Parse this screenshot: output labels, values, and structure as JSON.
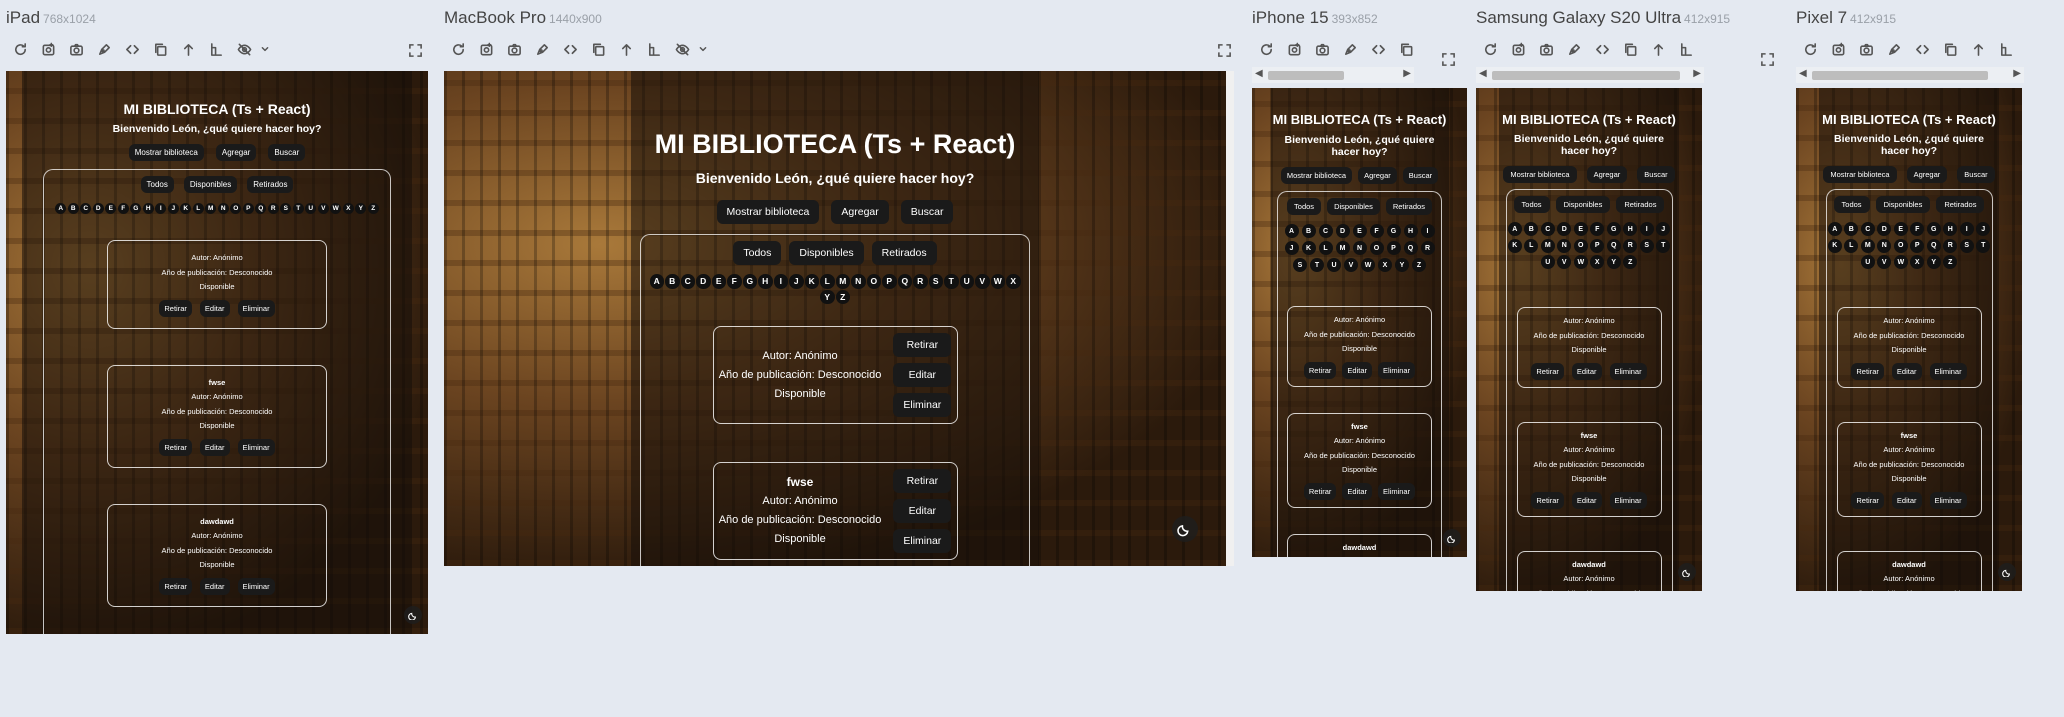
{
  "toolbar_icons": [
    "refresh-icon",
    "screenshot-icon",
    "camera-icon",
    "pen-icon",
    "code-icon",
    "copy-icon",
    "upload-icon",
    "rotate-icon",
    "hide-icon",
    "chevron-down-icon"
  ],
  "devices": {
    "ipad": {
      "name": "iPad",
      "dims": "768x1024"
    },
    "macbook": {
      "name": "MacBook Pro",
      "dims": "1440x900"
    },
    "iphone": {
      "name": "iPhone 15",
      "dims": "393x852"
    },
    "samsung": {
      "name": "Samsung Galaxy S20 Ultra",
      "dims": "412x915"
    },
    "pixel": {
      "name": "Pixel 7",
      "dims": "412x915"
    }
  },
  "app": {
    "title": "MI BIBLIOTECA (Ts + React)",
    "subtitle": "Bienvenido León, ¿qué quiere hacer hoy?",
    "nav": [
      "Mostrar biblioteca",
      "Agregar",
      "Buscar"
    ],
    "filters": [
      "Todos",
      "Disponibles",
      "Retirados"
    ],
    "letters": [
      "A",
      "B",
      "C",
      "D",
      "E",
      "F",
      "G",
      "H",
      "I",
      "J",
      "K",
      "L",
      "M",
      "N",
      "O",
      "P",
      "Q",
      "R",
      "S",
      "T",
      "U",
      "V",
      "W",
      "X",
      "Y",
      "Z"
    ],
    "actions": [
      "Retirar",
      "Editar",
      "Eliminar"
    ],
    "books": [
      {
        "title": "",
        "author": "Autor: Anónimo",
        "year": "Año de publicación: Desconocido",
        "status": "Disponible"
      },
      {
        "title": "fwse",
        "author": "Autor: Anónimo",
        "year": "Año de publicación: Desconocido",
        "status": "Disponible"
      },
      {
        "title": "dawdawd",
        "author": "Autor: Anónimo",
        "year": "Año de publicación: Desconocido",
        "status": "Disponible"
      }
    ]
  }
}
